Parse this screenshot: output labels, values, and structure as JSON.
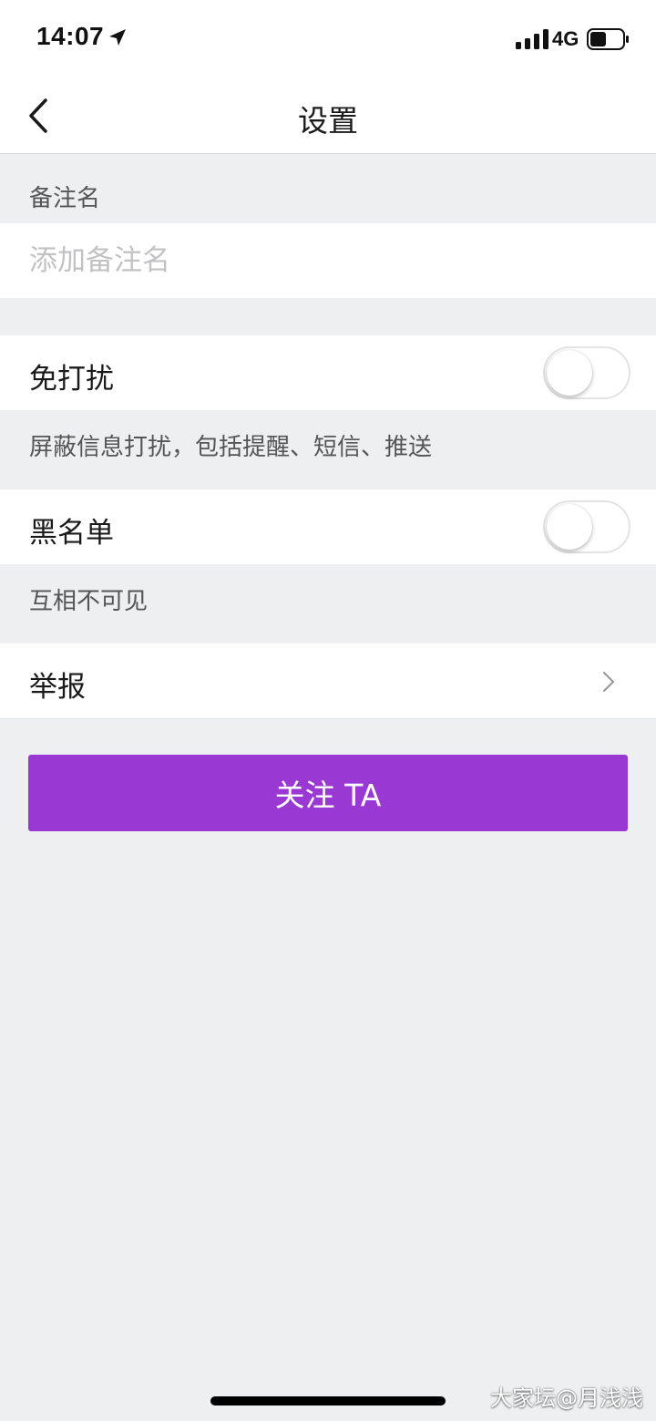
{
  "status_bar": {
    "time": "14:07",
    "location_icon": "location-arrow-icon",
    "signal_icon": "cellular-signal-icon",
    "network": "4G",
    "battery_icon": "battery-icon",
    "battery_level_percent": 50
  },
  "nav": {
    "back_icon": "chevron-left-icon",
    "title": "设置"
  },
  "remark": {
    "header": "备注名",
    "value": "",
    "placeholder": "添加备注名"
  },
  "do_not_disturb": {
    "label": "免打扰",
    "enabled": false,
    "description": "屏蔽信息打扰，包括提醒、短信、推送"
  },
  "blacklist": {
    "label": "黑名单",
    "enabled": false,
    "description": "互相不可见"
  },
  "report": {
    "label": "举报",
    "chevron_icon": "chevron-right-icon"
  },
  "follow_button": {
    "label": "关注 TA"
  },
  "watermark": "大家坛@月浅浅",
  "colors": {
    "accent": "#9a38d4",
    "background": "#eeeff1",
    "surface": "#ffffff",
    "secondary_text": "#555555",
    "placeholder_text": "#c2c2c4"
  }
}
